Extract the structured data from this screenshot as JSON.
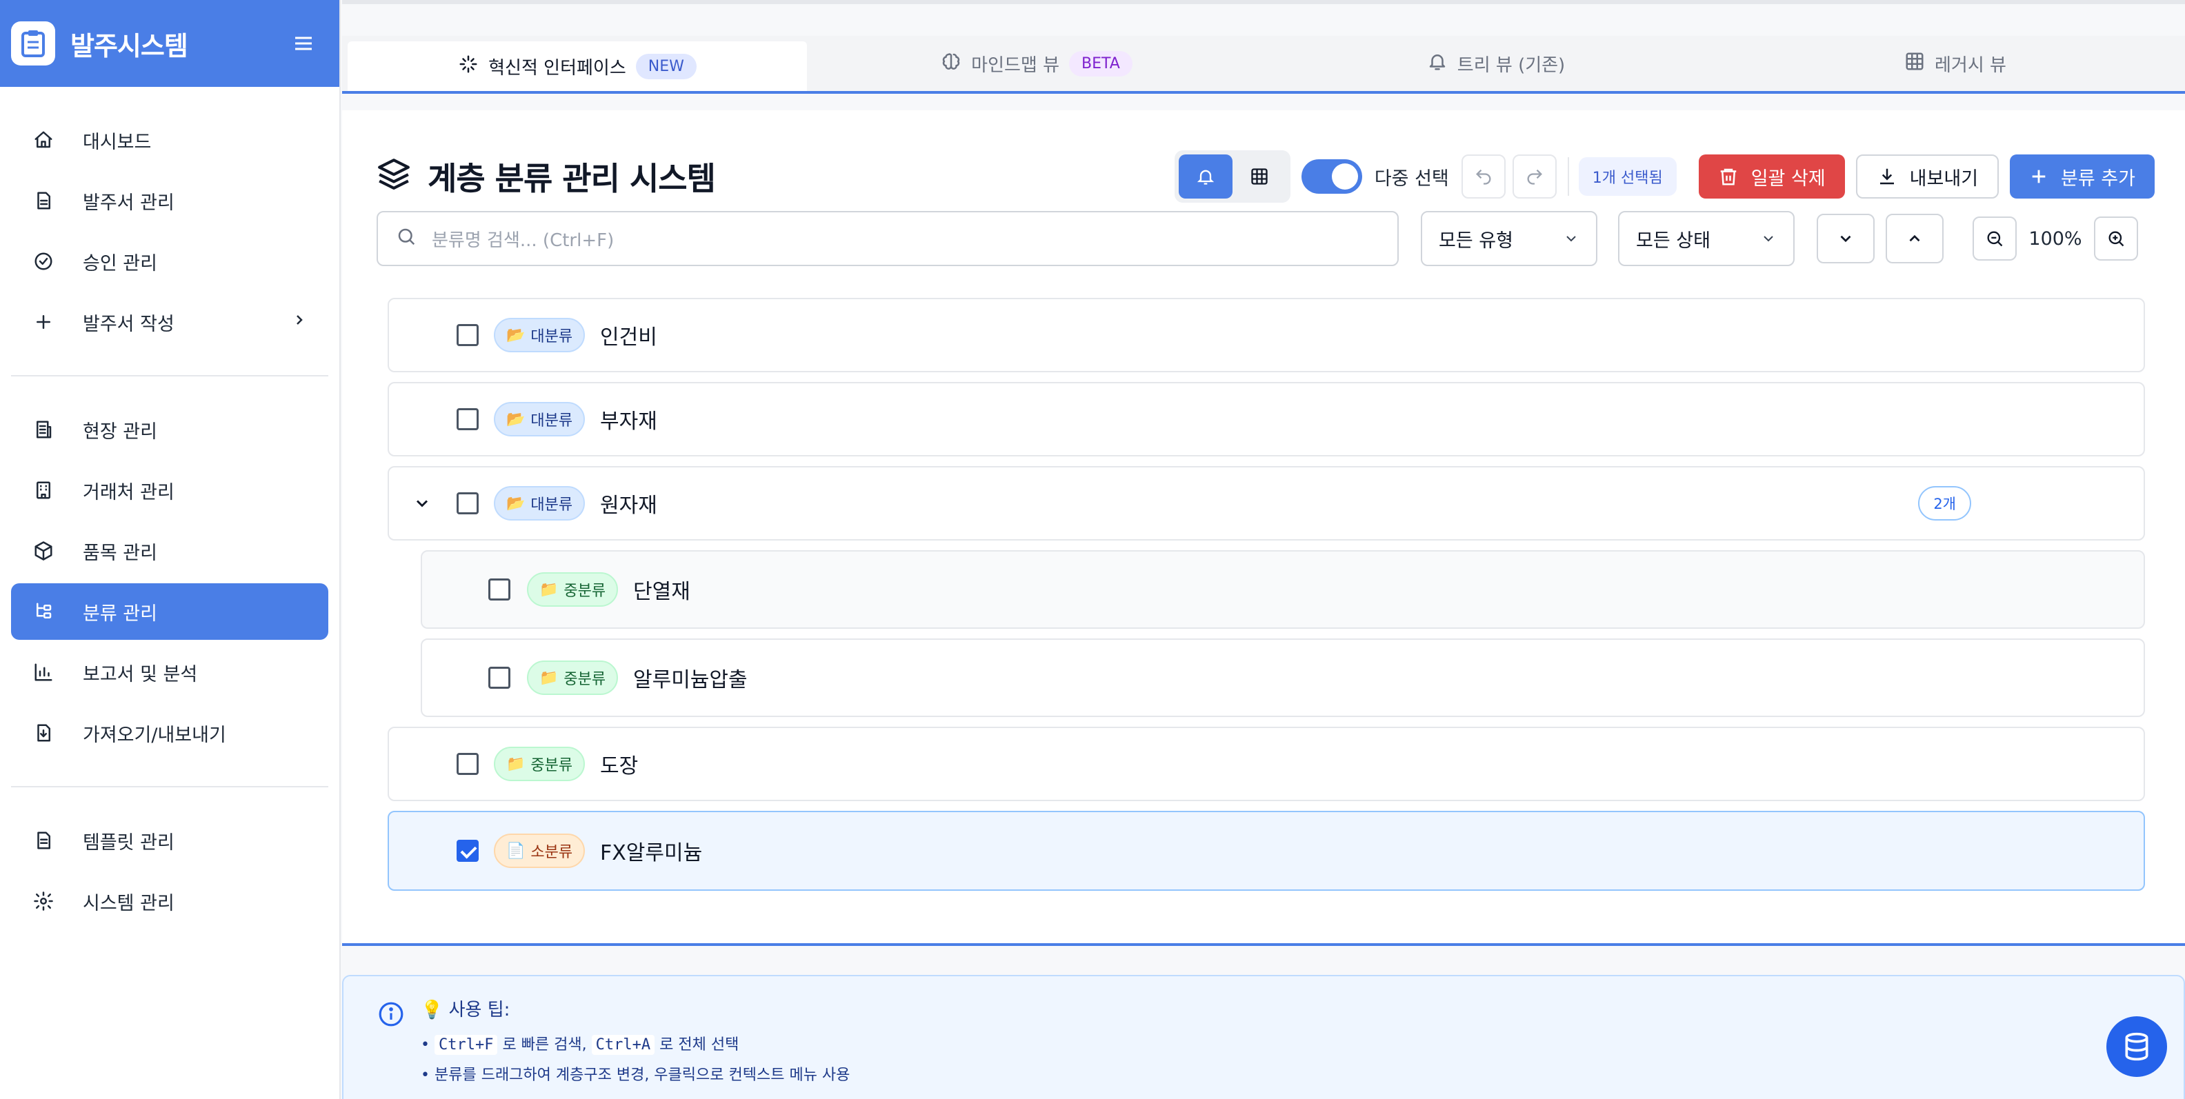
{
  "sidebar": {
    "app_title": "발주시스템",
    "groups": [
      [
        {
          "label": "대시보드",
          "icon": "home-icon"
        },
        {
          "label": "발주서 관리",
          "icon": "document-icon"
        },
        {
          "label": "승인 관리",
          "icon": "check-circle-icon"
        },
        {
          "label": "발주서 작성",
          "icon": "plus-icon",
          "has_submenu": true
        }
      ],
      [
        {
          "label": "현장 관리",
          "icon": "building-icon"
        },
        {
          "label": "거래처 관리",
          "icon": "office-icon"
        },
        {
          "label": "품목 관리",
          "icon": "box-icon"
        },
        {
          "label": "분류 관리",
          "icon": "hierarchy-icon",
          "active": true
        },
        {
          "label": "보고서 및 분석",
          "icon": "bar-chart-icon"
        },
        {
          "label": "가져오기/내보내기",
          "icon": "file-import-icon"
        }
      ],
      [
        {
          "label": "템플릿 관리",
          "icon": "template-icon"
        },
        {
          "label": "시스템 관리",
          "icon": "gear-icon"
        }
      ]
    ]
  },
  "tabs": [
    {
      "label": "혁신적 인터페이스",
      "badge": "NEW",
      "icon": "sparkle-icon",
      "active": true
    },
    {
      "label": "마인드맵 뷰",
      "badge": "BETA",
      "icon": "brain-icon"
    },
    {
      "label": "트리 뷰 (기존)",
      "badge": "",
      "icon": "bell-icon"
    },
    {
      "label": "레거시 뷰",
      "badge": "",
      "icon": "grid-icon"
    }
  ],
  "header": {
    "title": "계층 분류 관리 시스템",
    "multi_select_label": "다중 선택",
    "multi_select_on": true,
    "selected_count": "1개 선택됨",
    "bulk_delete": "일괄 삭제",
    "export": "내보내기",
    "add_category": "분류 추가"
  },
  "filters": {
    "search_placeholder": "분류명 검색... (Ctrl+F)",
    "type_select": "모든 유형",
    "status_select": "모든 상태",
    "zoom": "100%"
  },
  "rows": [
    {
      "type": "대분류",
      "name": "인건비",
      "level": 0,
      "checked": false
    },
    {
      "type": "대분류",
      "name": "부자재",
      "level": 0,
      "checked": false
    },
    {
      "type": "대분류",
      "name": "원자재",
      "level": 0,
      "checked": false,
      "expanded": true,
      "count": "2개"
    },
    {
      "type": "중분류",
      "name": "단열재",
      "level": 1,
      "checked": false
    },
    {
      "type": "중분류",
      "name": "알루미늄압출",
      "level": 1,
      "checked": false
    },
    {
      "type": "중분류",
      "name": "도장",
      "level": 0,
      "checked": false
    },
    {
      "type": "소분류",
      "name": "FX알루미늄",
      "level": 0,
      "checked": true
    }
  ],
  "tips": {
    "title": "사용 팁:",
    "tip1_key1": "Ctrl+F",
    "tip1_text1": " 로 빠른 검색, ",
    "tip1_key2": "Ctrl+A",
    "tip1_text2": " 로 전체 선택",
    "tip2": "분류를 드래그하여 계층구조 변경, 우클릭으로 컨텍스트 메뉴 사용"
  },
  "colors": {
    "primary": "#4a7ee6",
    "danger": "#e04646"
  }
}
